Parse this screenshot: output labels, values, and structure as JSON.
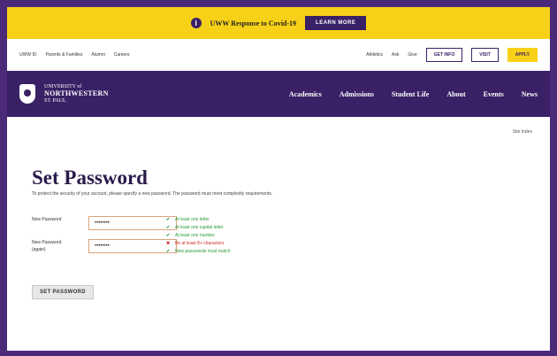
{
  "alert": {
    "text": "UWW Response to Covid-19",
    "button": "LEARN MORE"
  },
  "utility": {
    "left": [
      "UWW ID",
      "Parents & Families",
      "Alumni",
      "Careers"
    ],
    "right": [
      "Athletics",
      "Ask",
      "Give"
    ],
    "buttons": [
      "GET INFO",
      "VISIT",
      "APPLY"
    ]
  },
  "brand": {
    "line1": "UNIVERSITY of",
    "line2": "NORTHWESTERN",
    "line3": "ST. PAUL"
  },
  "nav": [
    "Academics",
    "Admissions",
    "Student Life",
    "About",
    "Events",
    "News"
  ],
  "site_index": "Site Index",
  "page": {
    "title": "Set Password",
    "description": "To protect the security of your account, please specify a new password. The password must meet complexity requirements."
  },
  "form": {
    "new_password_label": "New Password",
    "new_password_value": "••••••••",
    "confirm_label_1": "New Password",
    "confirm_label_2": "(again)",
    "confirm_value": "••••••••"
  },
  "requirements": [
    {
      "text": "At least one letter",
      "status": "ok"
    },
    {
      "text": "At least one capital letter",
      "status": "ok"
    },
    {
      "text": "At least one number",
      "status": "ok"
    },
    {
      "text": "Be at least 8+ characters",
      "status": "bad"
    },
    {
      "text": "New passwords must match",
      "status": "ok"
    }
  ],
  "submit_label": "SET PASSWORD",
  "colors": {
    "brand_purple": "#3a2166",
    "brand_gold": "#f7d117",
    "ok_green": "#2c9a3a",
    "error_red": "#d12a2a"
  }
}
